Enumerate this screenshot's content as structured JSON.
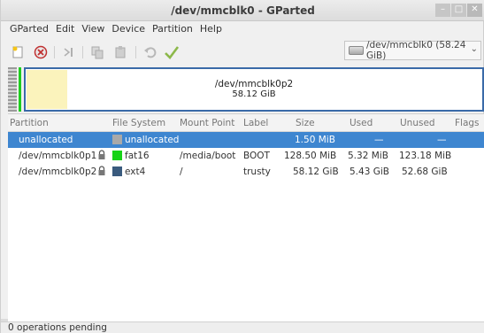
{
  "window": {
    "title": "/dev/mmcblk0 - GParted",
    "buttons": [
      "minimize",
      "maximize",
      "close"
    ]
  },
  "menu": {
    "items": [
      "GParted",
      "Edit",
      "View",
      "Device",
      "Partition",
      "Help"
    ]
  },
  "toolbar": {
    "icons": [
      "new-icon",
      "delete-icon",
      "resize-icon",
      "copy-icon",
      "paste-icon",
      "undo-icon",
      "apply-icon"
    ]
  },
  "device_selector": {
    "value": "/dev/mmcblk0  (58.24 GiB)"
  },
  "partition_map": {
    "selected_name": "/dev/mmcblk0p2",
    "selected_size": "58.12 GiB",
    "used_fraction_percent": 9
  },
  "table": {
    "columns": [
      "Partition",
      "File System",
      "Mount Point",
      "Label",
      "Size",
      "Used",
      "Unused",
      "Flags"
    ],
    "rows": [
      {
        "partition": "unallocated",
        "filesystem": "unallocated",
        "fs_color": "#a9a9a9",
        "mount": "",
        "label": "",
        "size": "1.50 MiB",
        "used": "—",
        "unused": "—",
        "flags": "",
        "selected": true,
        "locked": false
      },
      {
        "partition": "/dev/mmcblk0p1",
        "filesystem": "fat16",
        "fs_color": "#17d317",
        "mount": "/media/boot",
        "label": "BOOT",
        "size": "128.50 MiB",
        "used": "5.32 MiB",
        "unused": "123.18 MiB",
        "flags": "",
        "selected": false,
        "locked": true
      },
      {
        "partition": "/dev/mmcblk0p2",
        "filesystem": "ext4",
        "fs_color": "#3a5b7e",
        "mount": "/",
        "label": "trusty",
        "size": "58.12 GiB",
        "used": "5.43 GiB",
        "unused": "52.68 GiB",
        "flags": "",
        "selected": false,
        "locked": true
      }
    ]
  },
  "status": {
    "text": "0 operations pending"
  },
  "colors": {
    "selection": "#3e86d0",
    "map_border": "#3a6aa8",
    "used_fill": "#fbf3bc"
  }
}
